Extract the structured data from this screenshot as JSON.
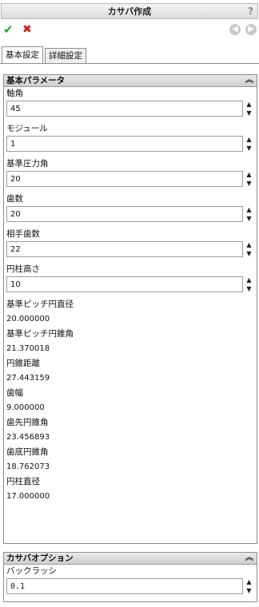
{
  "window": {
    "title": "カサバ作成",
    "help": "?"
  },
  "actions": {
    "ok": "✔",
    "cancel": "✖",
    "back": "◀",
    "forward": "▶"
  },
  "tabs": [
    {
      "label": "基本設定"
    },
    {
      "label": "詳細設定"
    }
  ],
  "basic_params": {
    "header": "基本パラメータ",
    "collapse": "︽",
    "fields": [
      {
        "label": "軸角",
        "value": "45"
      },
      {
        "label": "モジュール",
        "value": "1"
      },
      {
        "label": "基準圧力角",
        "value": "20"
      },
      {
        "label": "歯数",
        "value": "20"
      },
      {
        "label": "相手歯数",
        "value": "22"
      },
      {
        "label": "円柱高さ",
        "value": "10"
      }
    ],
    "readouts": [
      {
        "label": "基準ピッチ円直径",
        "value": "20.000000"
      },
      {
        "label": "基準ピッチ円錐角",
        "value": "21.370018"
      },
      {
        "label": "円錐距離",
        "value": "27.443159"
      },
      {
        "label": "歯幅",
        "value": "9.000000"
      },
      {
        "label": "歯先円錐角",
        "value": "23.456893"
      },
      {
        "label": "歯底円錐角",
        "value": "18.762073"
      },
      {
        "label": "円柱直径",
        "value": "17.000000"
      }
    ]
  },
  "gear_options": {
    "header": "カサバオプション",
    "collapse": "︽",
    "fields": [
      {
        "label": "バックラッシ",
        "value": "0.1"
      }
    ]
  }
}
